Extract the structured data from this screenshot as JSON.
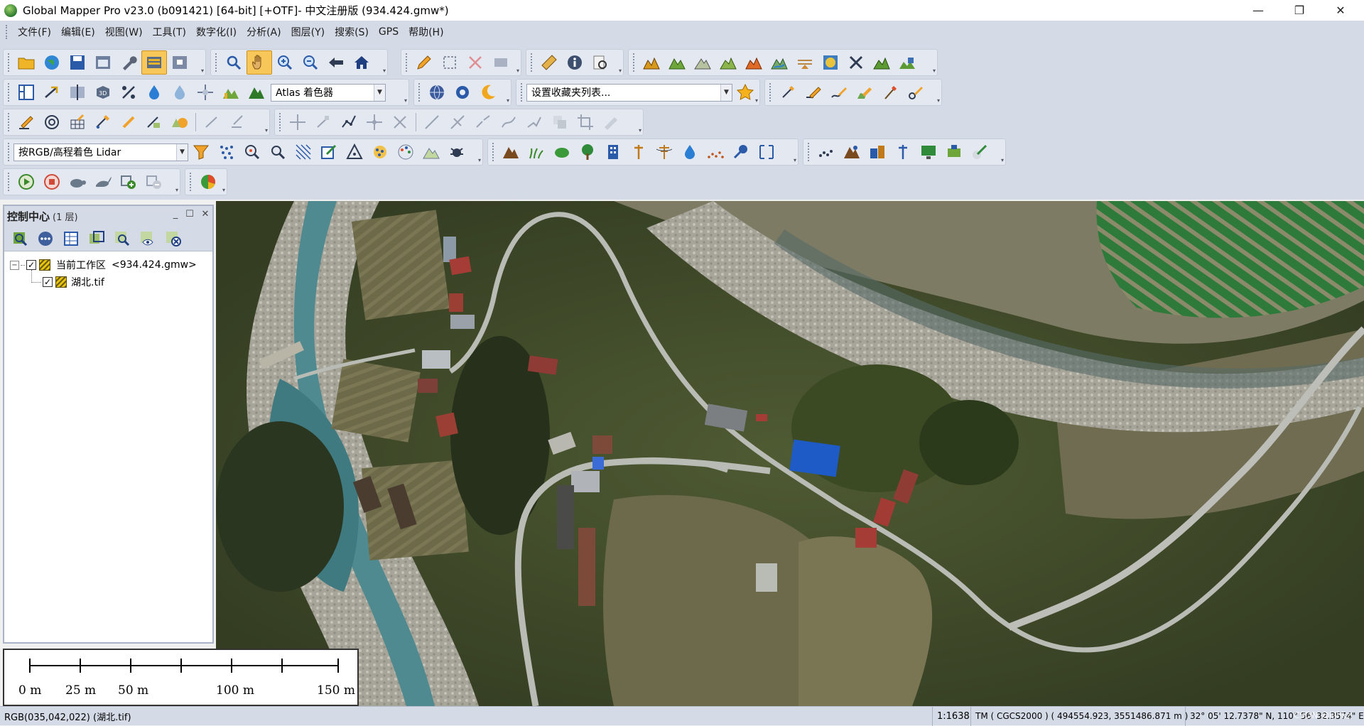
{
  "window": {
    "title": "Global Mapper Pro v23.0 (b091421) [64-bit] [+OTF]- 中文注册版 (934.424.gmw*)",
    "minimize": "—",
    "maximize": "❐",
    "close": "✕"
  },
  "menu": [
    "文件(F)",
    "编辑(E)",
    "视图(W)",
    "工具(T)",
    "数字化(I)",
    "分析(A)",
    "图层(Y)",
    "搜索(S)",
    "GPS",
    "帮助(H)"
  ],
  "toolbar": {
    "shader_combo": "Atlas 着色器",
    "favorites_combo": "设置收藏夹列表...",
    "lidar_combo": "按RGB/高程着色 Lidar"
  },
  "control_center": {
    "title": "控制中心",
    "layer_count": "(1 层)",
    "workspace_label": "当前工作区",
    "workspace_file": "<934.424.gmw>",
    "layer_name": "湖北.tif"
  },
  "scale_bar": {
    "labels": [
      "0 m",
      "25 m",
      "50 m",
      "100 m",
      "150 m"
    ]
  },
  "status": {
    "pixel_info": "RGB(035,042,022) (湖北.tif)",
    "scale": "1:1638",
    "projection": "TM ( CGCS2000 ) ( 494554.923, 3551486.871 m )",
    "geo_coords": "32° 05' 12.7378\" N, 110° 56' 32.3574\" E",
    "watermark": "CSDN @ljlhkz"
  },
  "colors": {
    "toolbar_bg": "#d5dbe6",
    "active_tool": "#f7c75a",
    "map_dark": "#3f4a2c",
    "river": "#4f8a90",
    "road": "#b9bbb5",
    "blue_roof": "#1e5bc6"
  }
}
